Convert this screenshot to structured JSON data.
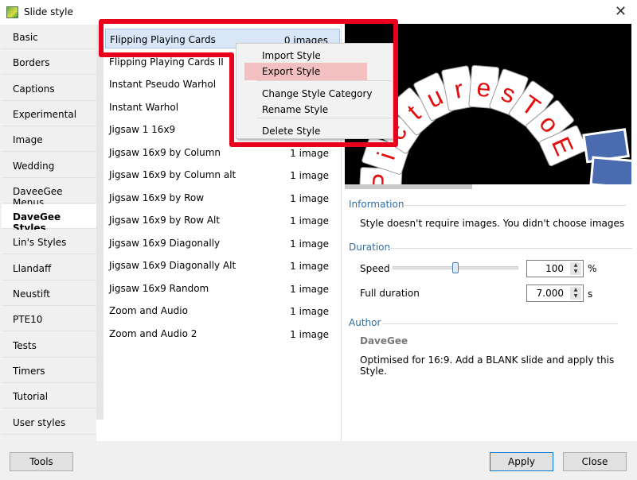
{
  "window": {
    "title": "Slide style",
    "close_icon": "close-icon"
  },
  "sidebar": {
    "items": [
      "Basic",
      "Borders",
      "Captions",
      "Experimental",
      "Image",
      "Wedding",
      "DaveeGee Menus",
      "DaveGee Styles",
      "Lin's Styles",
      "Llandaff",
      "Neustift",
      "PTE10",
      "Tests",
      "Timers",
      "Tutorial",
      "User styles"
    ],
    "selected": "DaveGee Styles"
  },
  "styles": [
    {
      "name": "Flipping Playing Cards",
      "count": "0 images"
    },
    {
      "name": "Flipping Playing Cards II",
      "count": ""
    },
    {
      "name": "Instant Pseudo Warhol",
      "count": ""
    },
    {
      "name": "Instant Warhol",
      "count": ""
    },
    {
      "name": "Jigsaw 1 16x9",
      "count": ""
    },
    {
      "name": "Jigsaw 16x9 by Column",
      "count": "1 image"
    },
    {
      "name": "Jigsaw 16x9 by Column alt",
      "count": "1 image"
    },
    {
      "name": "Jigsaw 16x9 by Row",
      "count": "1 image"
    },
    {
      "name": "Jigsaw 16x9 by Row Alt",
      "count": "1 image"
    },
    {
      "name": "Jigsaw 16x9 Diagonally",
      "count": "1 image"
    },
    {
      "name": "Jigsaw 16x9 Diagonally Alt",
      "count": "1 image"
    },
    {
      "name": "Jigsaw 16x9 Random",
      "count": "1 image"
    },
    {
      "name": "Zoom and Audio",
      "count": "1 image"
    },
    {
      "name": "Zoom and Audio 2",
      "count": "1 image"
    }
  ],
  "context_menu": {
    "items": [
      "Import Style",
      "Export Style",
      "Change Style Category",
      "Rename Style",
      "Delete Style"
    ],
    "highlighted": "Export Style"
  },
  "preview": {
    "letters": [
      "P",
      "i",
      "c",
      "t",
      "u",
      "r",
      "e",
      "s",
      "T",
      "o",
      "E"
    ]
  },
  "info": {
    "heading": "Information",
    "text": "Style doesn't require images. You didn't choose images"
  },
  "duration": {
    "heading": "Duration",
    "speed_label": "Speed",
    "speed_value": "100",
    "speed_unit": "%",
    "speed_slider_percent": 50,
    "full_label": "Full duration",
    "full_value": "7.000",
    "full_unit": "s"
  },
  "author": {
    "heading": "Author",
    "name": "DaveGee",
    "text": "Optimised for 16:9. Add a BLANK slide and apply this Style."
  },
  "buttons": {
    "tools": "Tools",
    "apply": "Apply",
    "close": "Close"
  },
  "colors": {
    "highlight_outline": "#e8001c",
    "menu_highlight": "#f2c0c0",
    "selection": "#d8e6f7",
    "group_heading": "#2e6da4"
  }
}
